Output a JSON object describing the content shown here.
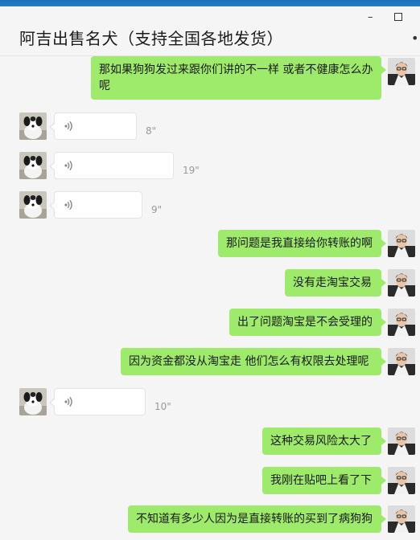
{
  "window": {
    "title": "阿吉出售名犬（支持全国各地发货）",
    "minimize_label": "–",
    "more_label": "•••"
  },
  "colors": {
    "outgoing_bubble": "#9eea6a",
    "incoming_bubble": "#ffffff",
    "background": "#f5f5f5",
    "title_bar_accent": "#1d6fb8"
  },
  "messages": [
    {
      "direction": "out",
      "type": "text",
      "text": "那如果狗狗发过来跟你们讲的不一样 或者不健康怎么办呢",
      "avatar": "user-avatar"
    },
    {
      "direction": "in",
      "type": "voice",
      "duration": "8\"",
      "avatar": "dog-avatar"
    },
    {
      "direction": "in",
      "type": "voice",
      "duration": "19\"",
      "avatar": "dog-avatar"
    },
    {
      "direction": "in",
      "type": "voice",
      "duration": "9\"",
      "avatar": "dog-avatar"
    },
    {
      "direction": "out",
      "type": "text",
      "text": "那问题是我直接给你转账的啊",
      "avatar": "user-avatar"
    },
    {
      "direction": "out",
      "type": "text",
      "text": "没有走淘宝交易",
      "avatar": "user-avatar"
    },
    {
      "direction": "out",
      "type": "text",
      "text": "出了问题淘宝是不会受理的",
      "avatar": "user-avatar"
    },
    {
      "direction": "out",
      "type": "text",
      "text": "因为资金都没从淘宝走  他们怎么有权限去处理呢",
      "avatar": "user-avatar"
    },
    {
      "direction": "in",
      "type": "voice",
      "duration": "10\"",
      "avatar": "dog-avatar"
    },
    {
      "direction": "out",
      "type": "text",
      "text": "这种交易风险太大了",
      "avatar": "user-avatar"
    },
    {
      "direction": "out",
      "type": "text",
      "text": "我刚在贴吧上看了下",
      "avatar": "user-avatar"
    },
    {
      "direction": "out",
      "type": "text",
      "text": "不知道有多少人因为是直接转账的买到了病狗狗",
      "avatar": "user-avatar"
    }
  ]
}
